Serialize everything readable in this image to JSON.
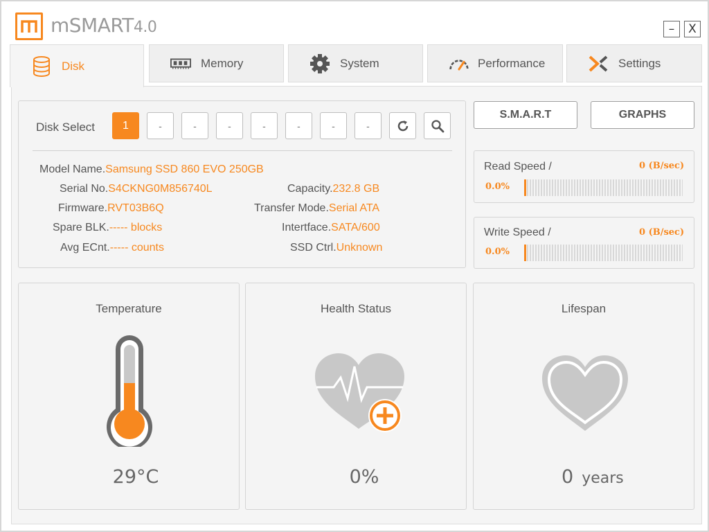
{
  "app": {
    "logo_letter": "m",
    "title_main": "mSMART",
    "title_version": "4.0"
  },
  "window_controls": {
    "minimize": "–",
    "close": "X"
  },
  "tabs": [
    {
      "label": "Disk",
      "icon": "database-icon",
      "active": true
    },
    {
      "label": "Memory",
      "icon": "memory-chip-icon",
      "active": false
    },
    {
      "label": "System",
      "icon": "gear-icon",
      "active": false
    },
    {
      "label": "Performance",
      "icon": "speedometer-icon",
      "active": false
    },
    {
      "label": "Settings",
      "icon": "settings-x-icon",
      "active": false
    }
  ],
  "disk_select": {
    "label": "Disk Select",
    "buttons": [
      "1",
      "-",
      "-",
      "-",
      "-",
      "-",
      "-",
      "-"
    ],
    "selected_index": 0
  },
  "disk_info": {
    "model_name": {
      "label": "Model Name.",
      "value": "Samsung SSD 860 EVO 250GB"
    },
    "serial_no": {
      "label": "Serial No.",
      "value": "S4CKNG0M856740L"
    },
    "firmware": {
      "label": "Firmware.",
      "value": "RVT03B6Q"
    },
    "spare_blk": {
      "label": "Spare BLK.",
      "value": "----- blocks"
    },
    "avg_ecnt": {
      "label": "Avg ECnt.",
      "value": "----- counts"
    },
    "capacity": {
      "label": "Capacity.",
      "value": "232.8 GB"
    },
    "transfer_mode": {
      "label": "Transfer Mode.",
      "value": "Serial ATA"
    },
    "interface": {
      "label": "Intertface.",
      "value": "SATA/600"
    },
    "ssd_ctrl": {
      "label": "SSD Ctrl.",
      "value": "Unknown"
    }
  },
  "actions": {
    "smart_label": "S.M.A.R.T",
    "graphs_label": "GRAPHS"
  },
  "read_speed": {
    "label": "Read Speed /",
    "value": "0 (B/sec)",
    "percent": "0.0%",
    "fill_fraction": 0.0
  },
  "write_speed": {
    "label": "Write Speed /",
    "value": "0 (B/sec)",
    "percent": "0.0%",
    "fill_fraction": 0.0
  },
  "temperature": {
    "title": "Temperature",
    "value": "29°C",
    "fill_fraction": 0.45
  },
  "health": {
    "title": "Health Status",
    "value": "0%"
  },
  "lifespan": {
    "title": "Lifespan",
    "value": "0",
    "unit": "years"
  },
  "colors": {
    "accent": "#f7881f",
    "icon_gray": "#c8c8c8",
    "text": "#555555"
  }
}
